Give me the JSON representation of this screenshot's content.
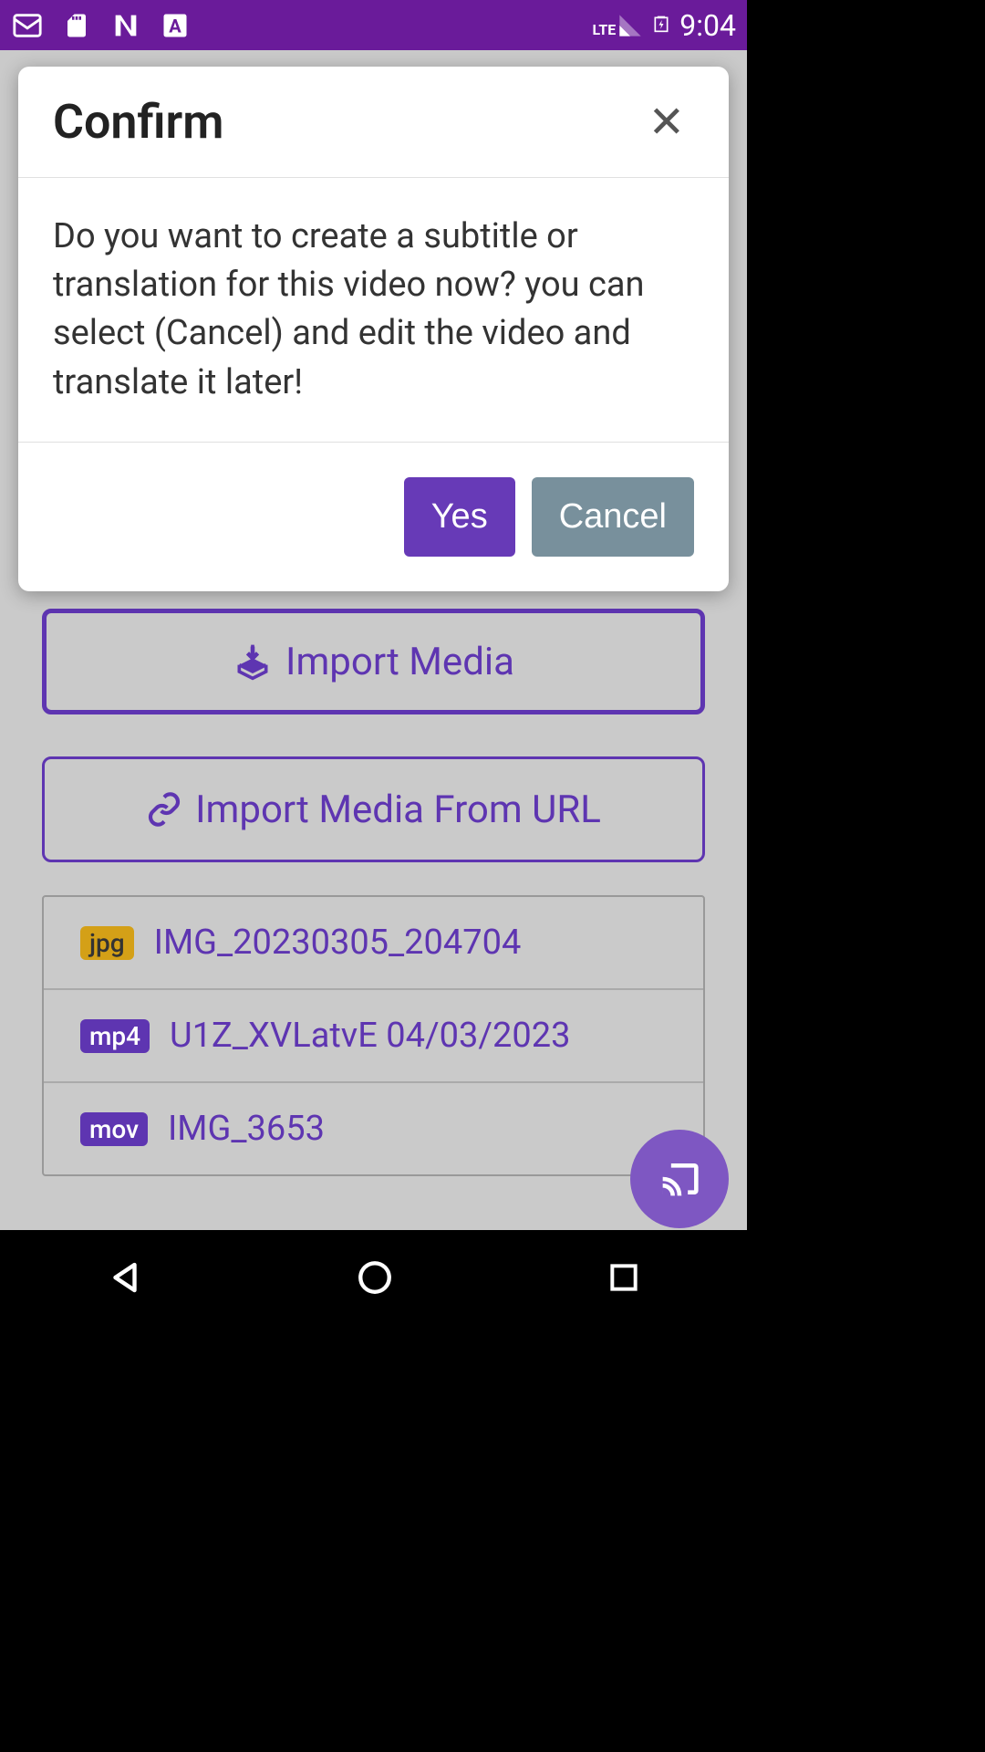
{
  "statusBar": {
    "time": "9:04",
    "lte": "LTE"
  },
  "modal": {
    "title": "Confirm",
    "body": "Do you want to create a subtitle or translation for this video now? you can select (Cancel) and edit the video and translate it later!",
    "yesLabel": "Yes",
    "cancelLabel": "Cancel"
  },
  "buttons": {
    "importMedia": "Import Media",
    "importUrl": "Import Media From URL"
  },
  "files": [
    {
      "badge": "jpg",
      "badgeClass": "badge-jpg",
      "name": "IMG_20230305_204704"
    },
    {
      "badge": "mp4",
      "badgeClass": "badge-mp4",
      "name": "U1Z_XVLatvE 04/03/2023"
    },
    {
      "badge": "mov",
      "badgeClass": "badge-mov",
      "name": "IMG_3653"
    }
  ]
}
